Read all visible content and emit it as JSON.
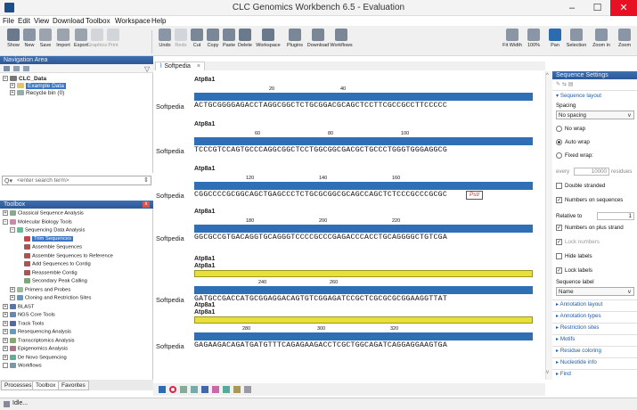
{
  "window": {
    "title": "CLC Genomics Workbench 6.5 - Evaluation",
    "minimize": "–",
    "maximize": "☐",
    "close": "✕"
  },
  "menu": [
    "File",
    "Edit",
    "View",
    "Download",
    "Toolbox",
    "Workspace",
    "Help"
  ],
  "toolbar": [
    {
      "label": "Show",
      "icon": "show-icon",
      "color": "#6a7a8c",
      "disabled": false
    },
    {
      "label": "New",
      "icon": "new-icon",
      "color": "#8a96a6",
      "disabled": false
    },
    {
      "label": "Save",
      "icon": "save-icon",
      "color": "#9aa3ae",
      "disabled": false
    },
    {
      "label": "Import",
      "icon": "import-icon",
      "color": "#9aa3ae",
      "disabled": false
    },
    {
      "label": "Export",
      "icon": "export-icon",
      "color": "#9aa3ae",
      "disabled": false
    },
    {
      "label": "Graphics",
      "icon": "graphics-icon",
      "color": "#9aa3ae",
      "disabled": true
    },
    {
      "label": "Print",
      "icon": "print-icon",
      "color": "#9aa3ae",
      "disabled": true
    },
    {
      "label": "Undo",
      "icon": "undo-icon",
      "color": "#8a96a6",
      "disabled": false
    },
    {
      "label": "Redo",
      "icon": "redo-icon",
      "color": "#9aa3ae",
      "disabled": true
    },
    {
      "label": "Cut",
      "icon": "cut-icon",
      "color": "#7a8796",
      "disabled": false
    },
    {
      "label": "Copy",
      "icon": "copy-icon",
      "color": "#7a8796",
      "disabled": false
    },
    {
      "label": "Paste",
      "icon": "paste-icon",
      "color": "#7a8796",
      "disabled": false
    },
    {
      "label": "Delete",
      "icon": "delete-icon",
      "color": "#6a7a8c",
      "disabled": false
    },
    {
      "label": "Workspace",
      "icon": "workspace-icon",
      "color": "#6a7a8c",
      "disabled": false
    },
    {
      "label": "Plugins",
      "icon": "plugins-icon",
      "color": "#7a8796",
      "disabled": false
    },
    {
      "label": "Download",
      "icon": "download-icon",
      "color": "#7a8796",
      "disabled": false
    },
    {
      "label": "Workflows",
      "icon": "workflows-icon",
      "color": "#7a8796",
      "disabled": false
    }
  ],
  "toolbar_right": [
    {
      "label": "Fit Width",
      "icon": "fit-width-icon"
    },
    {
      "label": "100%",
      "icon": "zoom-100-icon"
    },
    {
      "label": "Pan",
      "icon": "pan-hand-icon"
    },
    {
      "label": "Selection",
      "icon": "selection-arrow-icon"
    },
    {
      "label": "Zoom in",
      "icon": "zoom-in-icon"
    },
    {
      "label": "Zoom",
      "icon": "zoom-out-icon"
    }
  ],
  "navigation": {
    "title": "Navigation Area",
    "tree": [
      {
        "label": "CLC_Data",
        "bold": true,
        "icon": "database-icon"
      },
      {
        "label": "Example Data",
        "selected": true,
        "icon": "folder-icon"
      },
      {
        "label": "Recycle bin (0)",
        "icon": "recycle-bin-icon"
      }
    ],
    "search_placeholder": "<enter search term>"
  },
  "toolbox": {
    "title": "Toolbox",
    "items": [
      {
        "label": "Classical Sequence Analysis",
        "exp": "+"
      },
      {
        "label": "Molecular Biology Tools",
        "exp": "−"
      },
      {
        "label": "Sequencing Data Analysis",
        "exp": "−"
      },
      {
        "label": "Trim Sequences",
        "selected": true
      },
      {
        "label": "Assemble Sequences"
      },
      {
        "label": "Assemble Sequences to Reference"
      },
      {
        "label": "Add Sequences to Contig"
      },
      {
        "label": "Reassemble Contig"
      },
      {
        "label": "Secondary Peak Calling"
      },
      {
        "label": "Primers and Probes",
        "exp": "+"
      },
      {
        "label": "Cloning and Restriction Sites",
        "exp": "+"
      },
      {
        "label": "BLAST",
        "exp": "+"
      },
      {
        "label": "NGS Core Tools",
        "exp": "+"
      },
      {
        "label": "Track Tools",
        "exp": "+"
      },
      {
        "label": "Resequencing Analysis",
        "exp": "+"
      },
      {
        "label": "Transcriptomics Analysis",
        "exp": "+"
      },
      {
        "label": "Epigenomics Analysis",
        "exp": "+"
      },
      {
        "label": "De Novo Sequencing",
        "exp": "+"
      },
      {
        "label": "Workflows",
        "exp": ""
      }
    ]
  },
  "bottom_tabs": [
    "Processes",
    "Toolbox",
    "Favorites"
  ],
  "status": "Idle...",
  "editor": {
    "tab": "Softpedia",
    "tab_close": "×",
    "rows": [
      {
        "annotations": [
          "Atp8a1"
        ],
        "ticks": [
          "20",
          "40"
        ],
        "label": "Softpedia",
        "seq": "ACTGCGGGGAGACCTAGGCGGCTCTGCGGACGCAGCTCCTTCGCCGCCTTCCCCC",
        "yellow": false
      },
      {
        "annotations": [
          "Atp8a1"
        ],
        "ticks": [
          "60",
          "80",
          "100"
        ],
        "label": "Softpedia",
        "seq": "TCCCGTCCAGTGCCCAGGCGGCTCCTGGCGGCGACGCTGCCCTGGGTGGGAGGCG",
        "yellow": false
      },
      {
        "annotations": [
          "Atp8a1"
        ],
        "ticks": [
          "120",
          "140",
          "160"
        ],
        "label": "Softpedia",
        "seq": "CGGCCCCGCGGCAGCTGAGCCCTCTGCGCGGCGCAGCCAGCTCTCCCGCCCGCGC",
        "yellow": false
      },
      {
        "annotations": [
          "Atp8a1"
        ],
        "ticks": [
          "180",
          "200",
          "220"
        ],
        "label": "Softpedia",
        "seq": "GGCGCCGTGACAGGTGCAGGGTCCCCGCCCGAGACCCACCTGCAGGGGCTGTCGA",
        "yellow": false
      },
      {
        "annotations": [
          "Atp8a1",
          "Atp8a1"
        ],
        "ticks": [
          "240",
          "260"
        ],
        "label": "Softpedia",
        "seq": "GATGCCGACCATGCGGAGGACAGTGTCGGAGATCCGCTCGCGCGCGGAAGGTTAT",
        "yellow": true
      },
      {
        "annotations": [
          "Atp8a1",
          "Atp8a1"
        ],
        "ticks": [
          "280",
          "300",
          "320"
        ],
        "label": "Softpedia",
        "seq": "GAGAAGACAGATGATGTTTCAGAGAAGACCTCGCTGGCAGATCAGGAGGAAGTGA",
        "yellow": true
      }
    ],
    "restriction_site": "PstI"
  },
  "settings": {
    "title": "Sequence Settings",
    "layout_title": "Sequence layout",
    "spacing_label": "Spacing",
    "spacing_value": "No spacing",
    "wrap_options": [
      "No wrap",
      "Auto wrap",
      "Fixed wrap:"
    ],
    "wrap_selected": 1,
    "every_label": "every",
    "every_value": "10000",
    "residues_label": "residues",
    "checks1": [
      {
        "label": "Double stranded",
        "checked": false
      },
      {
        "label": "Numbers on sequences",
        "checked": true
      }
    ],
    "relative_label": "Relative to",
    "relative_value": "1",
    "checks2": [
      {
        "label": "Numbers on plus strand",
        "checked": true
      },
      {
        "label": "Lock numbers",
        "checked": true,
        "disabled": true
      },
      {
        "label": "Hide labels",
        "checked": false
      },
      {
        "label": "Lock labels",
        "checked": true
      }
    ],
    "seq_label_title": "Sequence label",
    "seq_label_value": "Name",
    "sections": [
      "Annotation layout",
      "Annotation types",
      "Restriction sites",
      "Motifs",
      "Residue coloring",
      "Nucleotide info",
      "Find"
    ]
  }
}
